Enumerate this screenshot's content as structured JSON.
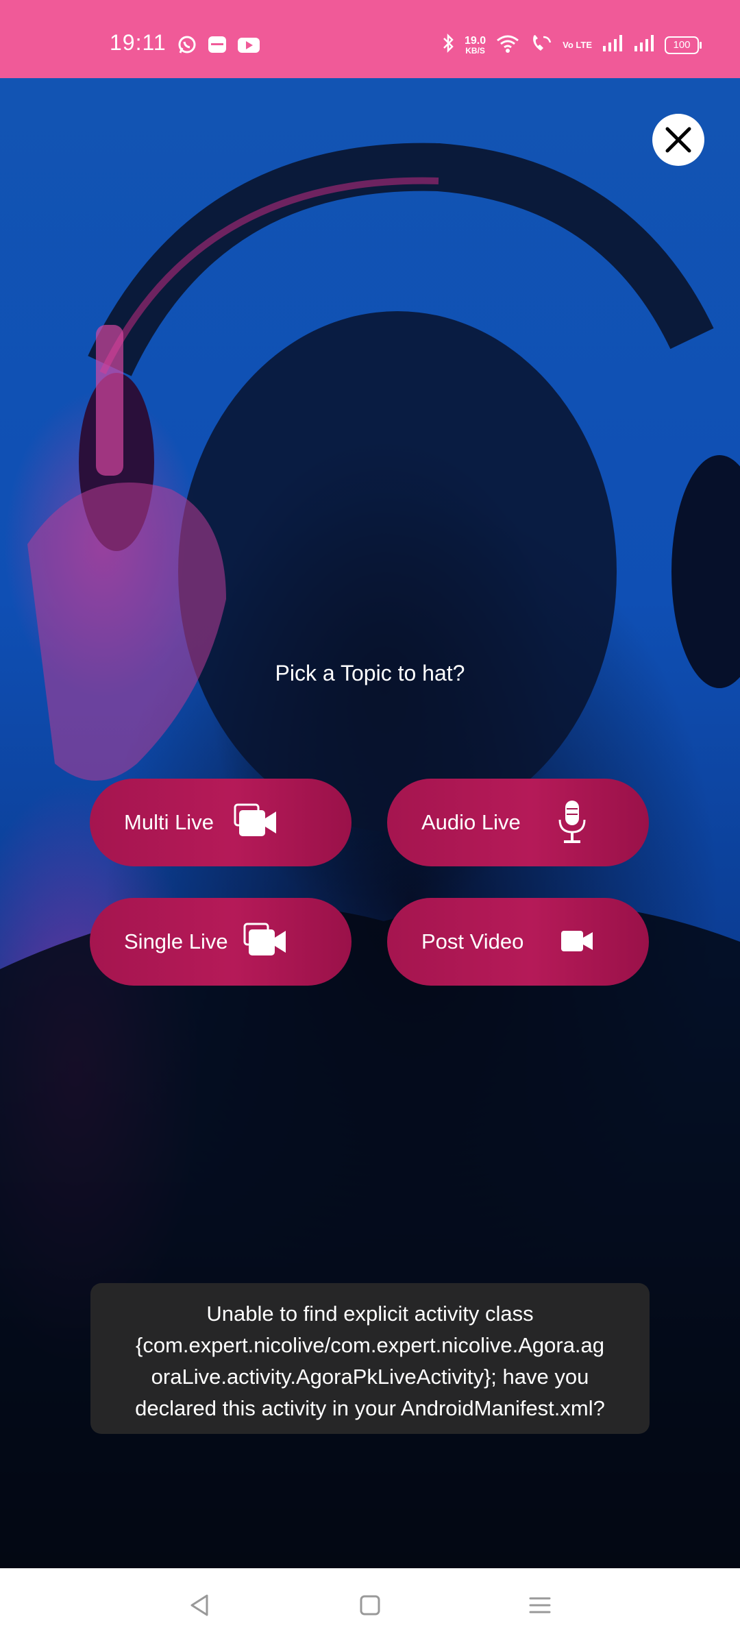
{
  "status_bar": {
    "time": "19:11",
    "left_icons": [
      "whatsapp-icon",
      "app-icon",
      "youtube-icon"
    ],
    "network_speed": "19.0",
    "network_speed_unit": "KB/S",
    "volte": "Vo LTE",
    "battery": "100",
    "color": "#f05a98"
  },
  "main": {
    "close_icon": "close-icon",
    "prompt": "Pick a Topic to hat?",
    "buttons": [
      {
        "label": "Multi Live",
        "icon": "video-camera-stack-icon"
      },
      {
        "label": "Audio Live",
        "icon": "microphone-icon"
      },
      {
        "label": "Single Live",
        "icon": "video-camera-stack-icon"
      },
      {
        "label": "Post Video",
        "icon": "video-camera-icon"
      }
    ],
    "button_color": "#a5154f"
  },
  "toast": {
    "lines": [
      "Unable to find explicit activity class",
      "{com.expert.nicolive/com.expert.nicolive.Agora.ag",
      "oraLive.activity.AgoraPkLiveActivity}; have you",
      "declared this activity in your AndroidManifest.xml?"
    ]
  },
  "nav_bar": {
    "icons": [
      "back-icon",
      "home-icon",
      "menu-icon"
    ]
  }
}
